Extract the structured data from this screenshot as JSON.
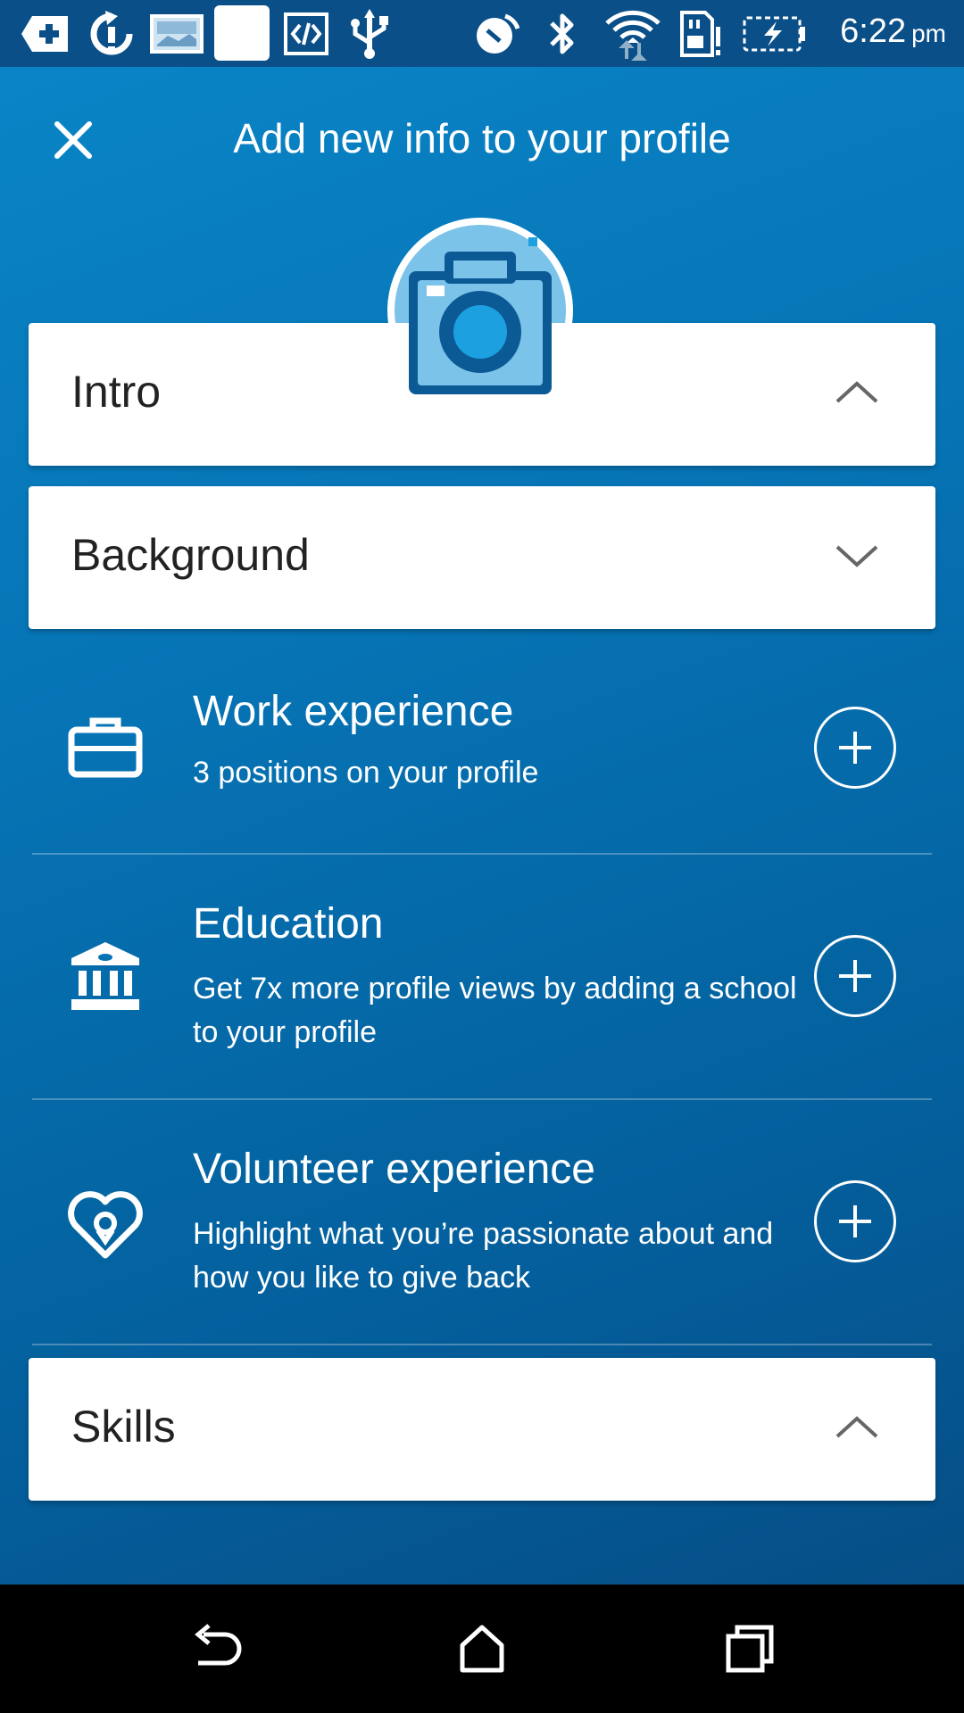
{
  "status_bar": {
    "time": "6:22",
    "ampm": "pm"
  },
  "header": {
    "title": "Add new info to your profile"
  },
  "sections": {
    "intro": {
      "label": "Intro",
      "state": "collapsed"
    },
    "background": {
      "label": "Background",
      "state": "expanded"
    },
    "skills": {
      "label": "Skills",
      "state": "collapsed"
    }
  },
  "background_items": [
    {
      "title": "Work experience",
      "subtitle": "3 positions on your profile",
      "icon": "briefcase-icon"
    },
    {
      "title": "Education",
      "subtitle": "Get 7x more profile views by adding a school to your profile",
      "icon": "school-icon"
    },
    {
      "title": "Volunteer experience",
      "subtitle": "Highlight what you’re passionate about and how you like to give back",
      "icon": "heart-icon"
    }
  ],
  "colors": {
    "background": "#0673b4",
    "status_bar": "#0a4f88",
    "card": "#ffffff",
    "camera_dark": "#0b5a96",
    "camera_light": "#7cc3ea",
    "camera_lens": "#1ca0e0"
  }
}
